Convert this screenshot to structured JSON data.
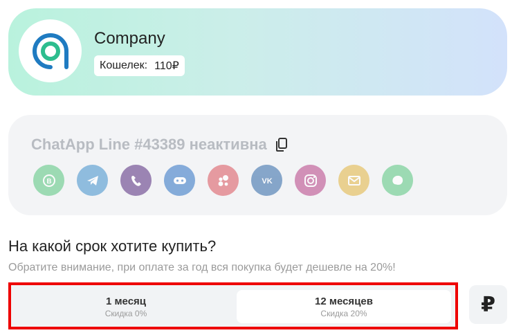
{
  "company": {
    "name": "Company",
    "wallet_label": "Кошелек:",
    "wallet_value": "110₽"
  },
  "line": {
    "title": "ChatApp Line #43389 неактивна",
    "channels": [
      {
        "name": "whatsapp-business",
        "color": "#7bd19a"
      },
      {
        "name": "telegram",
        "color": "#6aa7d6"
      },
      {
        "name": "viber",
        "color": "#7a5a9a"
      },
      {
        "name": "bot",
        "color": "#5a8fcf"
      },
      {
        "name": "avito",
        "color": "#e0787f"
      },
      {
        "name": "vk",
        "color": "#5c88b8"
      },
      {
        "name": "instagram",
        "color": "#c56aa0"
      },
      {
        "name": "email",
        "color": "#e6c36a"
      },
      {
        "name": "whatsapp",
        "color": "#7bd19a"
      }
    ]
  },
  "purchase": {
    "question": "На какой срок хотите купить?",
    "note": "Обратите внимание, при оплате за год вся покупка будет дешевле на 20%!",
    "options": [
      {
        "label": "1 месяц",
        "discount": "Скидка 0%"
      },
      {
        "label": "12 месяцев",
        "discount": "Скидка 20%"
      }
    ],
    "currency_symbol": "₽"
  },
  "colors": {
    "accent_red": "#ee0000",
    "logo_blue": "#1f7bc1",
    "logo_green": "#2dbd8e"
  }
}
